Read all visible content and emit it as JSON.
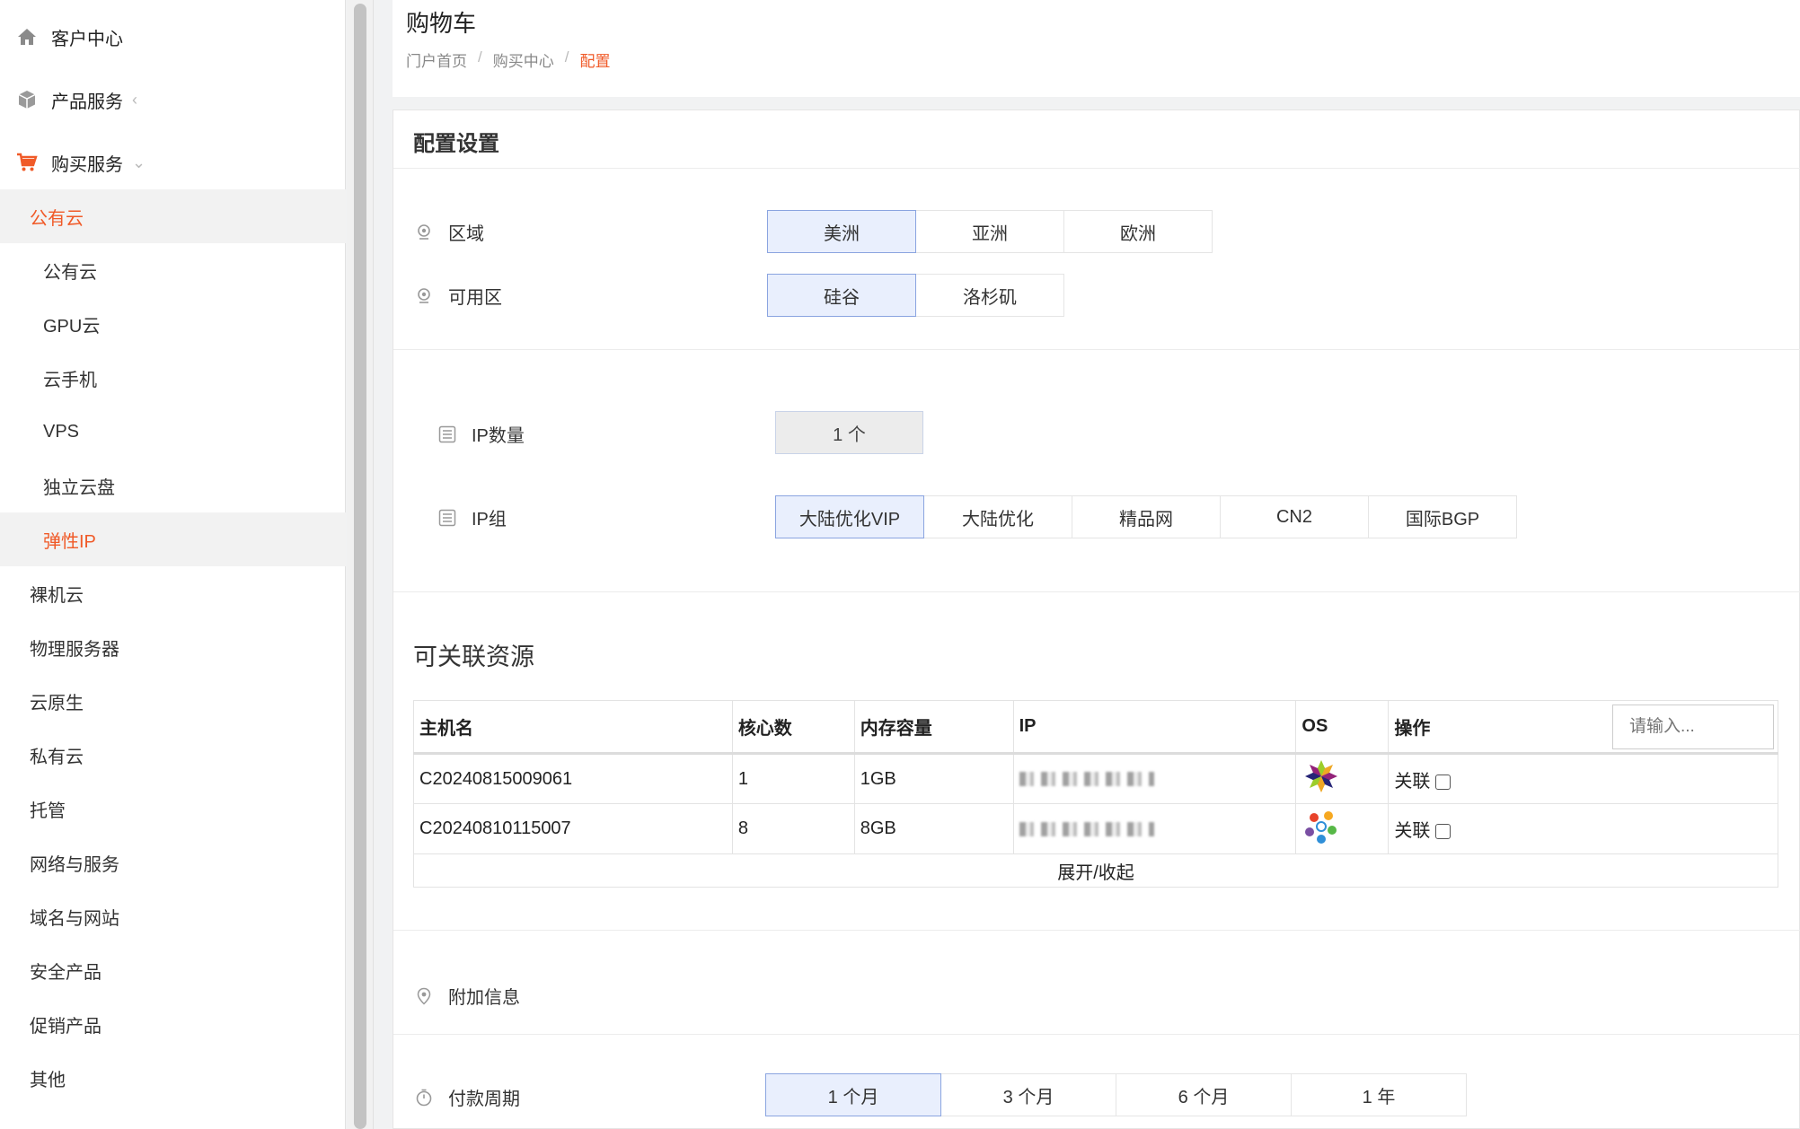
{
  "sidebar": {
    "top": [
      {
        "label": "客户中心",
        "icon": "home-icon"
      },
      {
        "label": "产品服务",
        "icon": "box-icon",
        "caret": "‹"
      },
      {
        "label": "购买服务",
        "icon": "cart-icon",
        "caret": "⌄"
      }
    ],
    "items": [
      {
        "label": "公有云"
      },
      {
        "label": "公有云"
      },
      {
        "label": "GPU云"
      },
      {
        "label": "云手机"
      },
      {
        "label": "VPS"
      },
      {
        "label": "独立云盘"
      },
      {
        "label": "弹性IP"
      },
      {
        "label": "裸机云"
      },
      {
        "label": "物理服务器"
      },
      {
        "label": "云原生"
      },
      {
        "label": "私有云"
      },
      {
        "label": "托管"
      },
      {
        "label": "网络与服务"
      },
      {
        "label": "域名与网站"
      },
      {
        "label": "安全产品"
      },
      {
        "label": "促销产品"
      },
      {
        "label": "其他"
      }
    ]
  },
  "header": {
    "title": "购物车",
    "breadcrumb": [
      "门户首页",
      "购买中心",
      "配置"
    ],
    "separator": "/"
  },
  "config": {
    "title": "配置设置",
    "region": {
      "label": "区域",
      "options": [
        "美洲",
        "亚洲",
        "欧洲"
      ],
      "selected": "美洲"
    },
    "zone": {
      "label": "可用区",
      "options": [
        "硅谷",
        "洛杉矶"
      ],
      "selected": "硅谷"
    },
    "ip_count": {
      "label": "IP数量",
      "value": "1 个"
    },
    "ip_group": {
      "label": "IP组",
      "options": [
        "大陆优化VIP",
        "大陆优化",
        "精品网",
        "CN2",
        "国际BGP"
      ],
      "selected": "大陆优化VIP"
    }
  },
  "resources": {
    "title": "可关联资源",
    "columns": [
      "主机名",
      "核心数",
      "内存容量",
      "IP",
      "OS",
      "操作"
    ],
    "search_placeholder": "请输入...",
    "rows": [
      {
        "hostname": "C20240815009061",
        "cores": "1",
        "memory": "1GB",
        "os_icon": "centos-icon",
        "action": "关联"
      },
      {
        "hostname": "C20240810115007",
        "cores": "8",
        "memory": "8GB",
        "os_icon": "fedora-icon",
        "action": "关联"
      }
    ],
    "expand_label": "展开/收起"
  },
  "extra": {
    "label": "附加信息"
  },
  "payment": {
    "label": "付款周期",
    "options": [
      "1 个月",
      "3 个月",
      "6 个月",
      "1 年"
    ],
    "selected": "1 个月"
  },
  "colors": {
    "accent": "#f05a28",
    "selected_bg": "#e9effd",
    "selected_border": "#8aa4e0"
  }
}
